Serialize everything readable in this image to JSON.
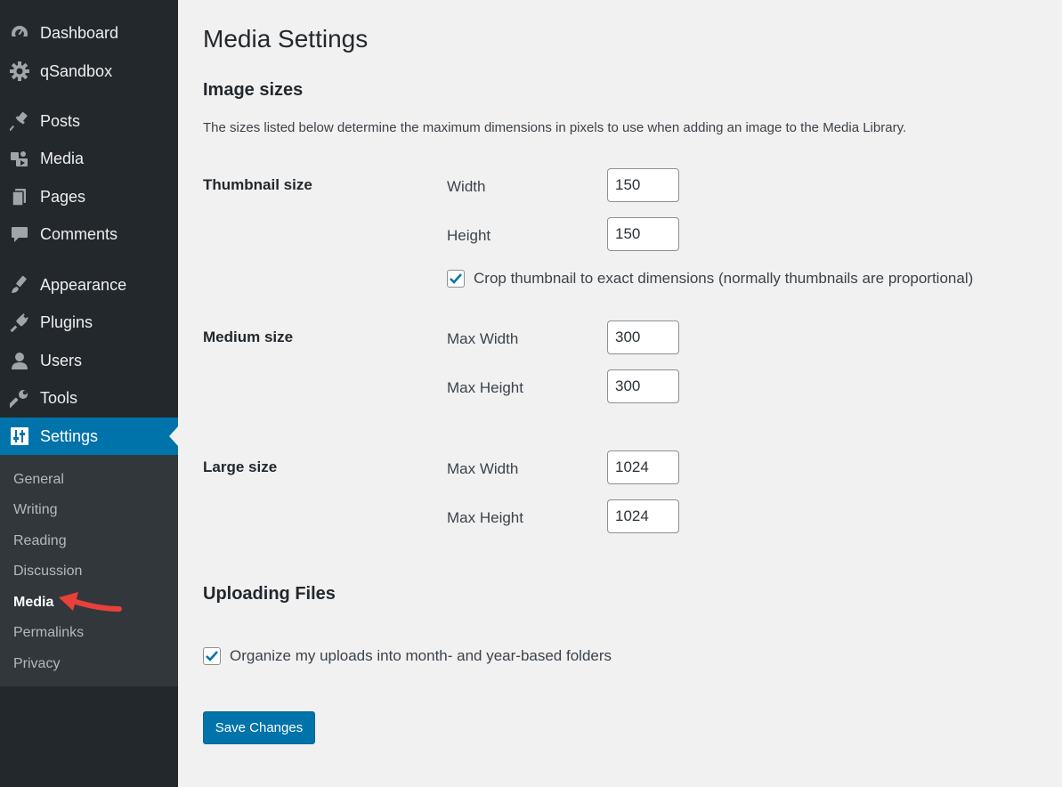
{
  "sidebar": {
    "items": [
      {
        "label": "Dashboard",
        "icon": "dashboard-icon"
      },
      {
        "label": "qSandbox",
        "icon": "gear-icon"
      },
      {
        "label": "Posts",
        "icon": "pushpin-icon"
      },
      {
        "label": "Media",
        "icon": "media-icon"
      },
      {
        "label": "Pages",
        "icon": "pages-icon"
      },
      {
        "label": "Comments",
        "icon": "comment-icon"
      },
      {
        "label": "Appearance",
        "icon": "paintbrush-icon"
      },
      {
        "label": "Plugins",
        "icon": "plug-icon"
      },
      {
        "label": "Users",
        "icon": "user-icon"
      },
      {
        "label": "Tools",
        "icon": "wrench-icon"
      },
      {
        "label": "Settings",
        "icon": "settings-icon"
      }
    ],
    "submenu": [
      "General",
      "Writing",
      "Reading",
      "Discussion",
      "Media",
      "Permalinks",
      "Privacy"
    ],
    "current_item": "Settings",
    "current_subitem": "Media"
  },
  "main": {
    "page_title": "Media Settings",
    "image_sizes": {
      "title": "Image sizes",
      "description": "The sizes listed below determine the maximum dimensions in pixels to use when adding an image to the Media Library.",
      "thumbnail": {
        "label": "Thumbnail size",
        "width_label": "Width",
        "width_value": "150",
        "height_label": "Height",
        "height_value": "150",
        "crop_label": "Crop thumbnail to exact dimensions (normally thumbnails are proportional)",
        "crop_checked": true
      },
      "medium": {
        "label": "Medium size",
        "width_label": "Max Width",
        "width_value": "300",
        "height_label": "Max Height",
        "height_value": "300"
      },
      "large": {
        "label": "Large size",
        "width_label": "Max Width",
        "width_value": "1024",
        "height_label": "Max Height",
        "height_value": "1024"
      }
    },
    "uploading": {
      "title": "Uploading Files",
      "organize_label": "Organize my uploads into month- and year-based folders",
      "organize_checked": true
    },
    "save_label": "Save Changes"
  },
  "colors": {
    "sidebar_bg": "#23282d",
    "submenu_bg": "#32373c",
    "accent": "#0073aa",
    "page_bg": "#f1f1f1",
    "annotation": "#e8403a"
  }
}
